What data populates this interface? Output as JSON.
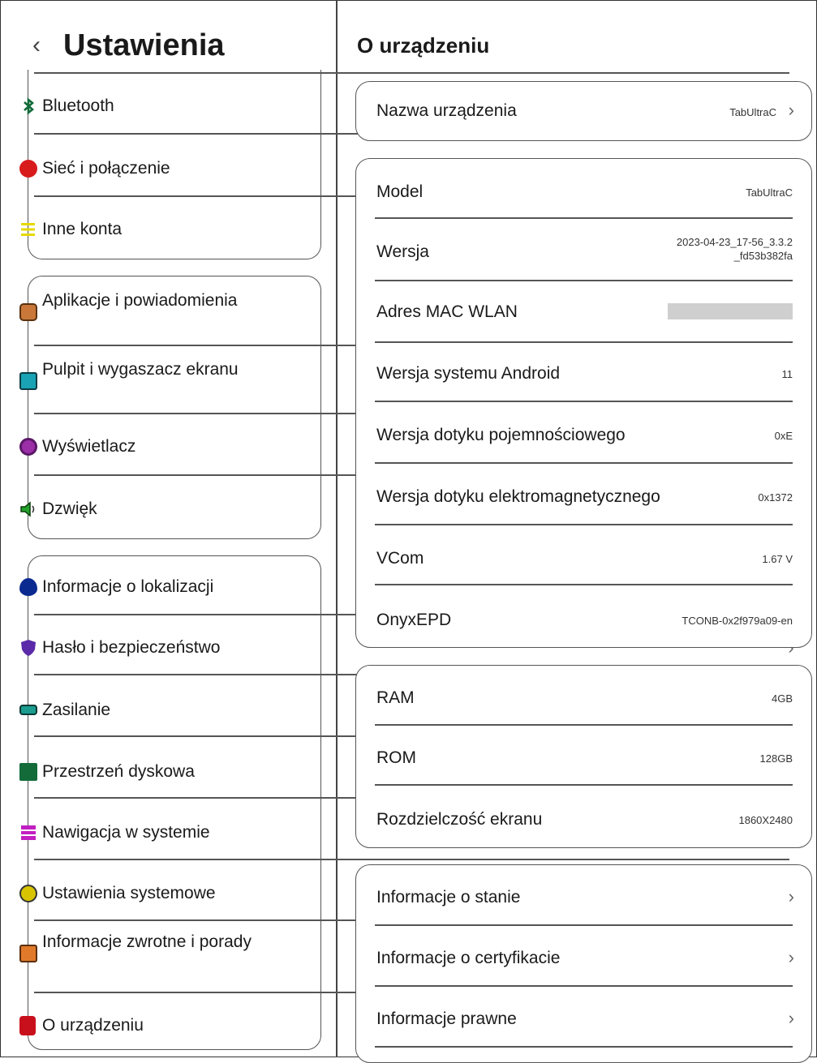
{
  "header": {
    "back_glyph": "‹",
    "title": "Ustawienia"
  },
  "left_menu": [
    {
      "label": "Bluetooth",
      "icon": "bluetooth-icon"
    },
    {
      "label": "Sieć i połączenie",
      "icon": "network-icon",
      "color": "#d81b1b"
    },
    {
      "label": "Inne konta",
      "icon": "accounts-icon",
      "color": "#e6d800"
    },
    {
      "label": "Aplikacje i powiadomienia",
      "icon": "apps-icon",
      "color": "#c9783a"
    },
    {
      "label": "Pulpit i wygaszacz ekranu",
      "icon": "screensaver-icon",
      "color": "#1aa3b5"
    },
    {
      "label": "Wyświetlacz",
      "icon": "display-icon",
      "color": "#9b2fa8"
    },
    {
      "label": "Dzwięk",
      "icon": "sound-icon",
      "color": "#22a22a"
    },
    {
      "label": "Informacje o lokalizacji",
      "icon": "location-icon",
      "color": "#0b2a8f"
    },
    {
      "label": "Hasło i bezpieczeństwo",
      "icon": "security-icon",
      "color": "#5a2aa8"
    },
    {
      "label": "Zasilanie",
      "icon": "battery-icon",
      "color": "#1a9c8f"
    },
    {
      "label": "Przestrzeń dyskowa",
      "icon": "storage-icon",
      "color": "#136b3a"
    },
    {
      "label": "Nawigacja w systemie",
      "icon": "navigation-icon",
      "color": "#c21ec2"
    },
    {
      "label": "Ustawienia systemowe",
      "icon": "system-settings-icon",
      "color": "#d8c400"
    },
    {
      "label": "Informacje zwrotne i porady",
      "icon": "feedback-icon",
      "color": "#e07a2a"
    },
    {
      "label": "O urządzeniu",
      "icon": "device-icon",
      "color": "#c8101c"
    }
  ],
  "chevron": "›",
  "checkmark": "✓",
  "right_title": "O urządzeniu",
  "device_name": {
    "label": "Nazwa urządzenia",
    "value": "TabUltraC"
  },
  "info": [
    {
      "label": "Model",
      "value": "TabUltraC"
    },
    {
      "label": "Wersja",
      "value": "2023-04-23_17-56_3.3.2\n_fd53b382fa"
    },
    {
      "label": "Adres MAC WLAN",
      "value": ""
    },
    {
      "label": "Wersja systemu Android",
      "value": "11"
    },
    {
      "label": "Wersja dotyku pojemnościowego",
      "value": "0xE"
    },
    {
      "label": "Wersja dotyku elektromagnetycznego",
      "value": "0x1372"
    },
    {
      "label": "VCom",
      "value": "1.67 V"
    },
    {
      "label": "OnyxEPD",
      "value": "TCONB-0x2f979a09-en"
    }
  ],
  "hardware": [
    {
      "label": "RAM",
      "value": "4GB"
    },
    {
      "label": "ROM",
      "value": "128GB"
    },
    {
      "label": "Rozdzielczość ekranu",
      "value": "1860X2480"
    }
  ],
  "links": [
    {
      "label": "Informacje o stanie"
    },
    {
      "label": "Informacje o certyfikacie"
    },
    {
      "label": "Informacje prawne"
    }
  ]
}
